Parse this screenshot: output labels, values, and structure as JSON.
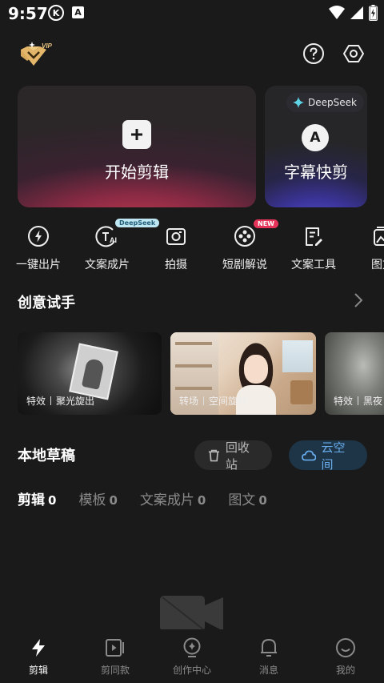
{
  "status": {
    "time": "9:57",
    "k": "K",
    "a": "A"
  },
  "cards": {
    "main_label": "开始剪辑",
    "sub_label": "字幕快剪",
    "sub_badge": "DeepSeek",
    "sub_letter": "A"
  },
  "tools": [
    {
      "label": "一键出片",
      "icon": "lightning-icon"
    },
    {
      "label": "文案成片",
      "icon": "text-ai-icon",
      "badge": "DeepSeek"
    },
    {
      "label": "拍摄",
      "icon": "camera-icon"
    },
    {
      "label": "短剧解说",
      "icon": "film-reel-icon",
      "badge": "NEW"
    },
    {
      "label": "文案工具",
      "icon": "doc-edit-icon"
    },
    {
      "label": "图文",
      "icon": "image-text-icon"
    }
  ],
  "creative": {
    "title": "创意试手",
    "items": [
      {
        "type": "特效",
        "name": "聚光旋出"
      },
      {
        "type": "转场",
        "name": "空间旋转"
      },
      {
        "type": "特效",
        "name": "黑夜"
      }
    ]
  },
  "drafts": {
    "title": "本地草稿",
    "recycle": "回收站",
    "cloud": "云空间",
    "tabs": [
      {
        "label": "剪辑",
        "count": "0"
      },
      {
        "label": "模板",
        "count": "0"
      },
      {
        "label": "文案成片",
        "count": "0"
      },
      {
        "label": "图文",
        "count": "0"
      }
    ]
  },
  "nav": [
    {
      "label": "剪辑"
    },
    {
      "label": "剪同款"
    },
    {
      "label": "创作中心"
    },
    {
      "label": "消息"
    },
    {
      "label": "我的"
    }
  ],
  "colors": {
    "accent_blue": "#6aaef0",
    "card_red": "#c0394f",
    "card_blue": "#5b55d8",
    "badge_new": "#e5335a"
  }
}
